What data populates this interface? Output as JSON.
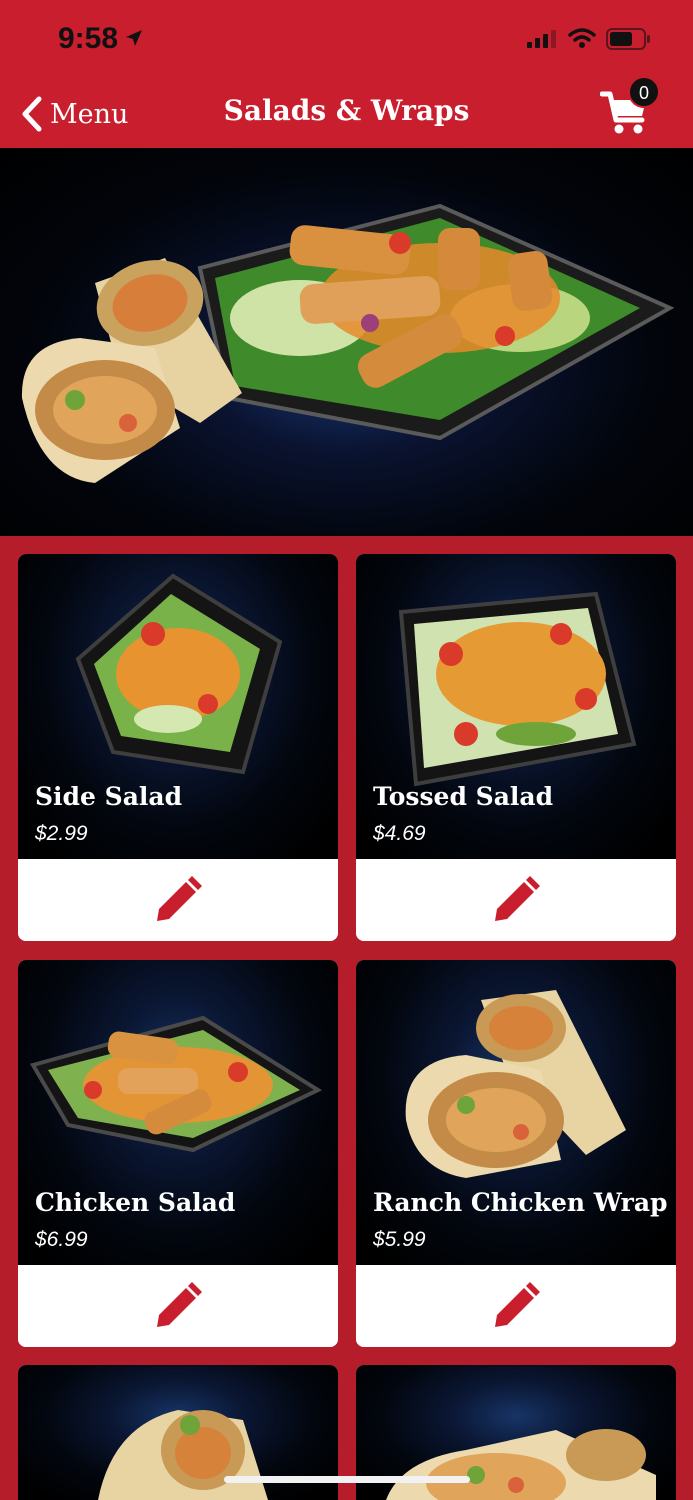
{
  "status_bar": {
    "time": "9:58"
  },
  "nav": {
    "back_label": "Menu",
    "title": "Salads & Wraps",
    "cart_count": "0"
  },
  "colors": {
    "brand_red": "#c91e2e",
    "background_red": "#b51d2b",
    "card_dark": "#000000"
  },
  "items": [
    {
      "name": "Side Salad",
      "price": "$2.99",
      "action_icon": "pencil-icon"
    },
    {
      "name": "Tossed Salad",
      "price": "$4.69",
      "action_icon": "pencil-icon"
    },
    {
      "name": "Chicken Salad",
      "price": "$6.99",
      "action_icon": "pencil-icon"
    },
    {
      "name": "Ranch Chicken Wrap",
      "price": "$5.99",
      "action_icon": "pencil-icon"
    }
  ]
}
